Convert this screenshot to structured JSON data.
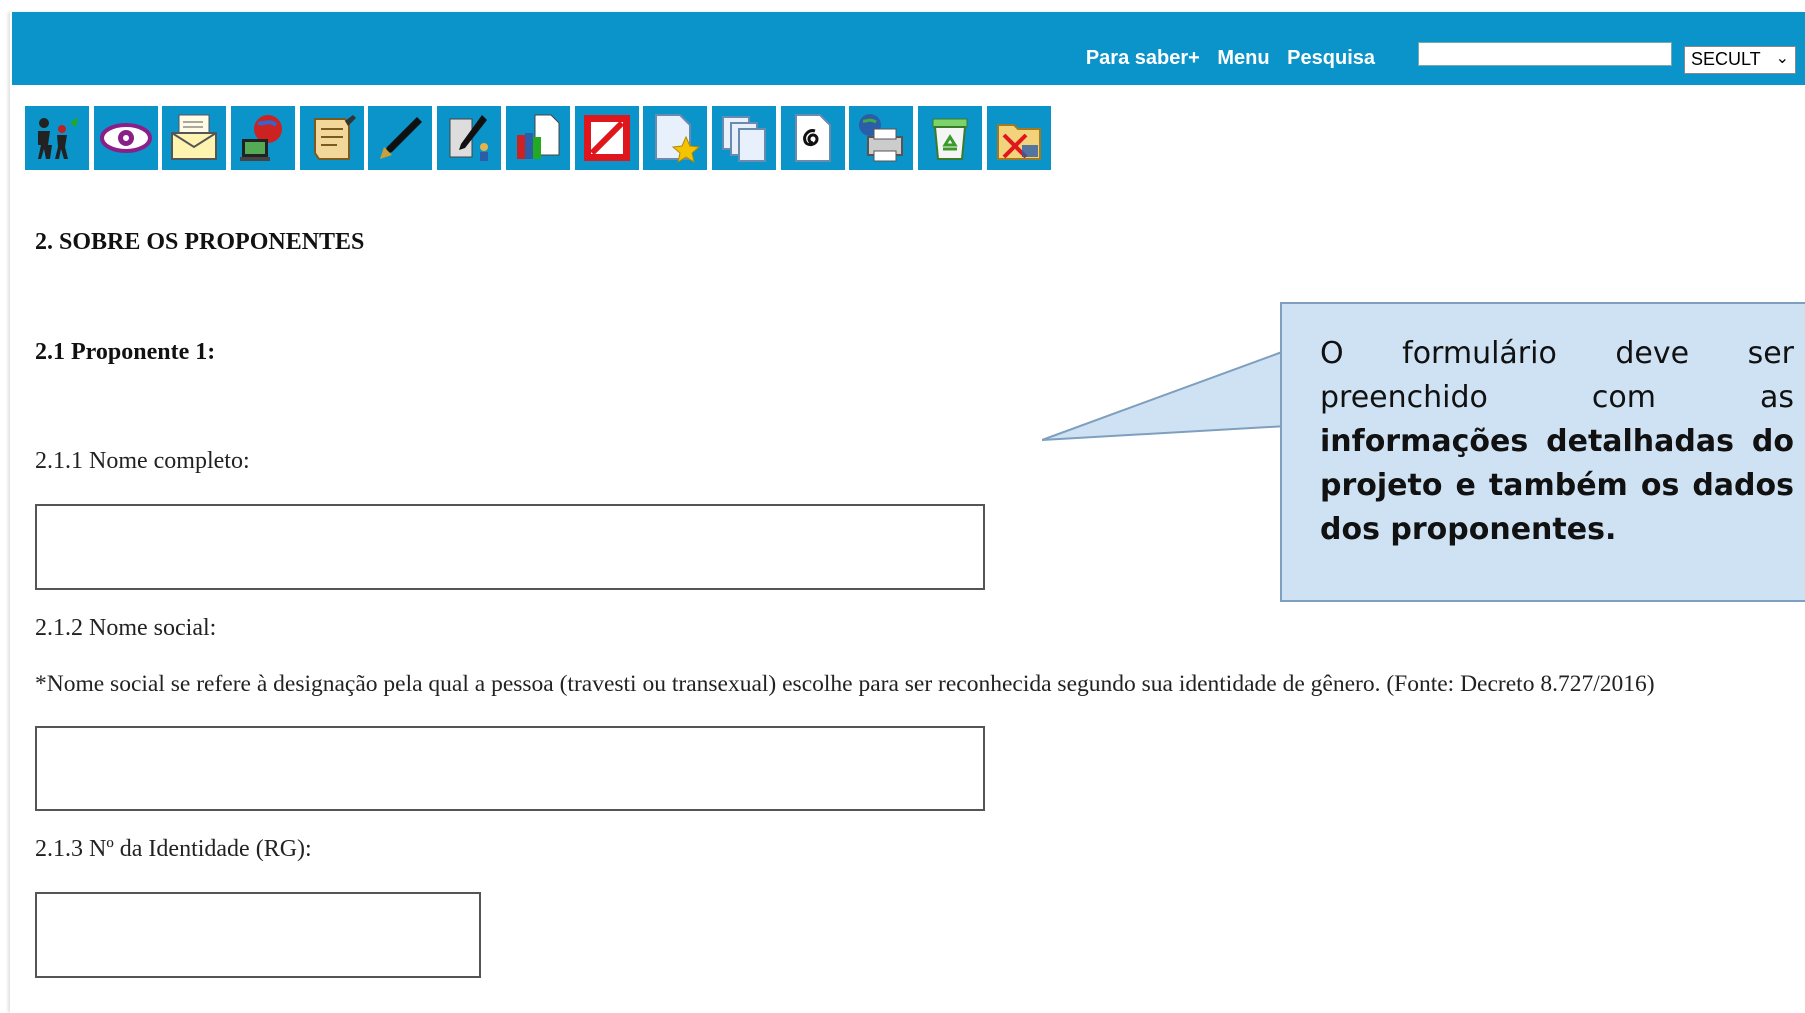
{
  "topbar": {
    "links": [
      "Para saber+",
      "Menu",
      "Pesquisa"
    ],
    "search": {
      "value": "",
      "placeholder": ""
    },
    "unit_select": {
      "selected": "SECULT"
    },
    "background_color": "#0a94c9"
  },
  "toolbar": {
    "icons": [
      "people-icon",
      "eye-icon",
      "envelope-icon",
      "globe-computer-icon",
      "document-edit-icon",
      "pen-icon",
      "pen-person-icon",
      "books-document-icon",
      "cancel-icon",
      "favorite-document-icon",
      "copy-documents-icon",
      "spiral-document-icon",
      "print-globe-icon",
      "recycle-bin-icon",
      "folder-delete-icon"
    ]
  },
  "form": {
    "section_title": "2. SOBRE OS PROPONENTES",
    "subsection_title": "2.1 Proponente 1:",
    "fields": {
      "nome_completo": {
        "label": "2.1.1 Nome completo:",
        "value": ""
      },
      "nome_social": {
        "label": "2.1.2 Nome social:",
        "note": "*Nome social se refere à designação pela qual a pessoa (travesti ou transexual) escolhe para ser reconhecida segundo sua identidade de gênero. (Fonte: Decreto 8.727/2016)",
        "value": ""
      },
      "identidade": {
        "label": "2.1.3 Nº da Identidade (RG):",
        "value": ""
      }
    }
  },
  "callout": {
    "text_plain": "O formulário deve ser preenchido com as",
    "text_bold": "informações detalhadas do projeto e também os dados dos proponentes.",
    "background_color": "#cfe2f3"
  }
}
